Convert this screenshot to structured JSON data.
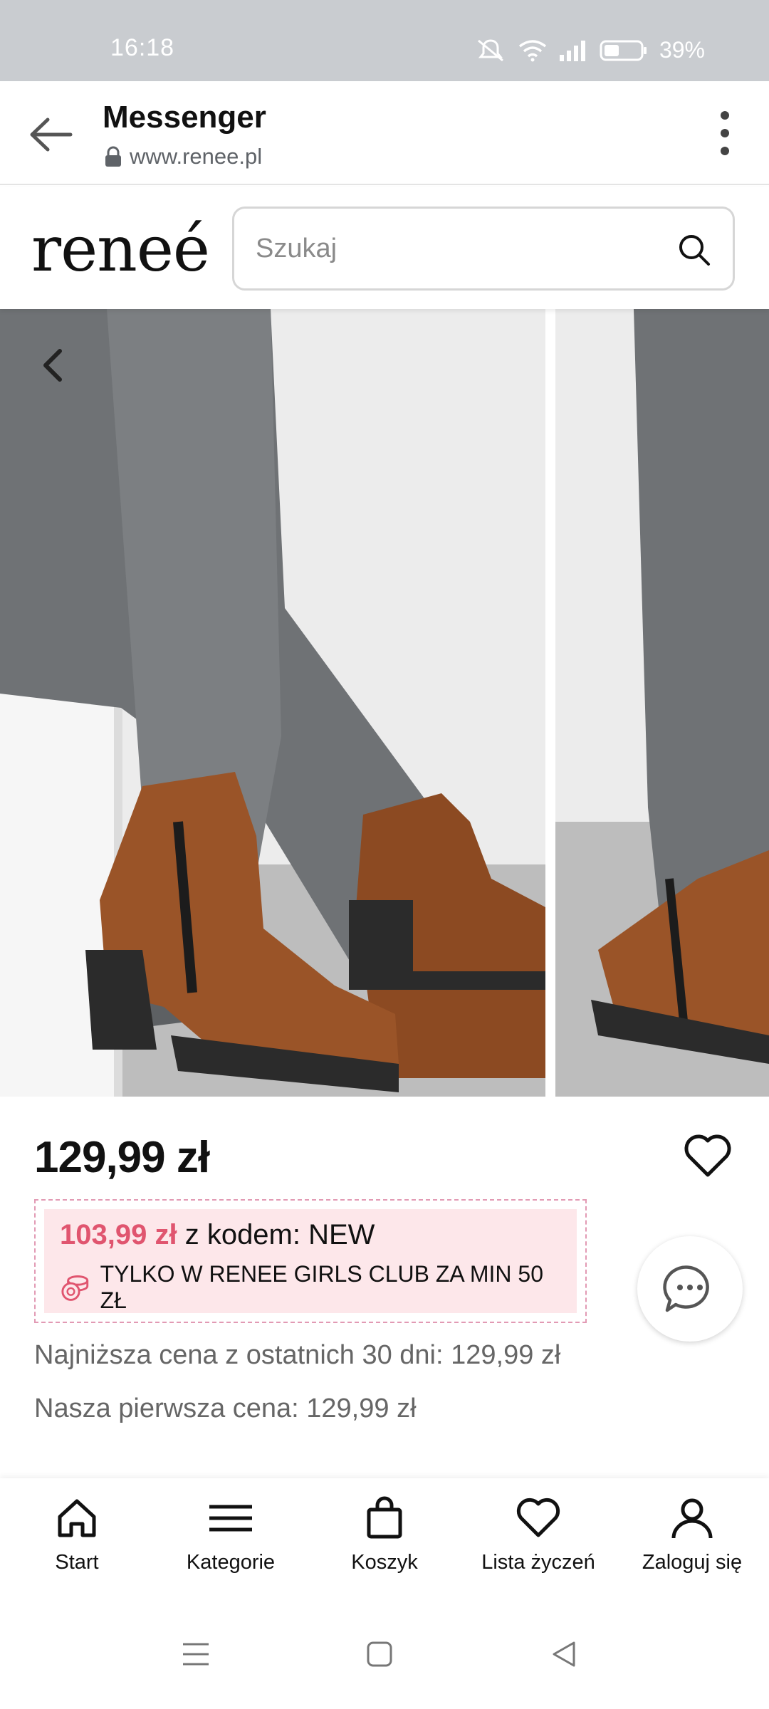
{
  "status_bar": {
    "time": "16:18",
    "battery": "39%",
    "icons": [
      "mute-icon",
      "wifi-icon",
      "signal-icon",
      "battery-icon"
    ]
  },
  "browser": {
    "title": "Messenger",
    "url": "www.renee.pl"
  },
  "site": {
    "logo": "reneé",
    "search_placeholder": "Szukaj"
  },
  "product": {
    "price": "129,99 zł",
    "promo": {
      "price": "103,99 zł",
      "code_text": "z kodem: NEW",
      "club_text": "TYLKO W RENEE GIRLS CLUB ZA MIN 50 ZŁ"
    },
    "lowest_price_note": "Najniższa cena z ostatnich 30 dni: 129,99 zł",
    "first_price_note": "Nasza pierwsza cena: 129,99 zł"
  },
  "bottom_nav": {
    "items": [
      {
        "label": "Start",
        "icon": "home-icon"
      },
      {
        "label": "Kategorie",
        "icon": "hamburger-icon"
      },
      {
        "label": "Koszyk",
        "icon": "bag-icon"
      },
      {
        "label": "Lista życzeń",
        "icon": "heart-icon"
      },
      {
        "label": "Zaloguj się",
        "icon": "user-icon"
      }
    ]
  },
  "colors": {
    "status_bar": "#c9ccd0",
    "promo_bg": "#fde7ea",
    "promo_price": "#e0556f",
    "promo_border": "#e29ab4",
    "boot_brown": "#9a5428",
    "jeans_grey": "#6f7275"
  }
}
